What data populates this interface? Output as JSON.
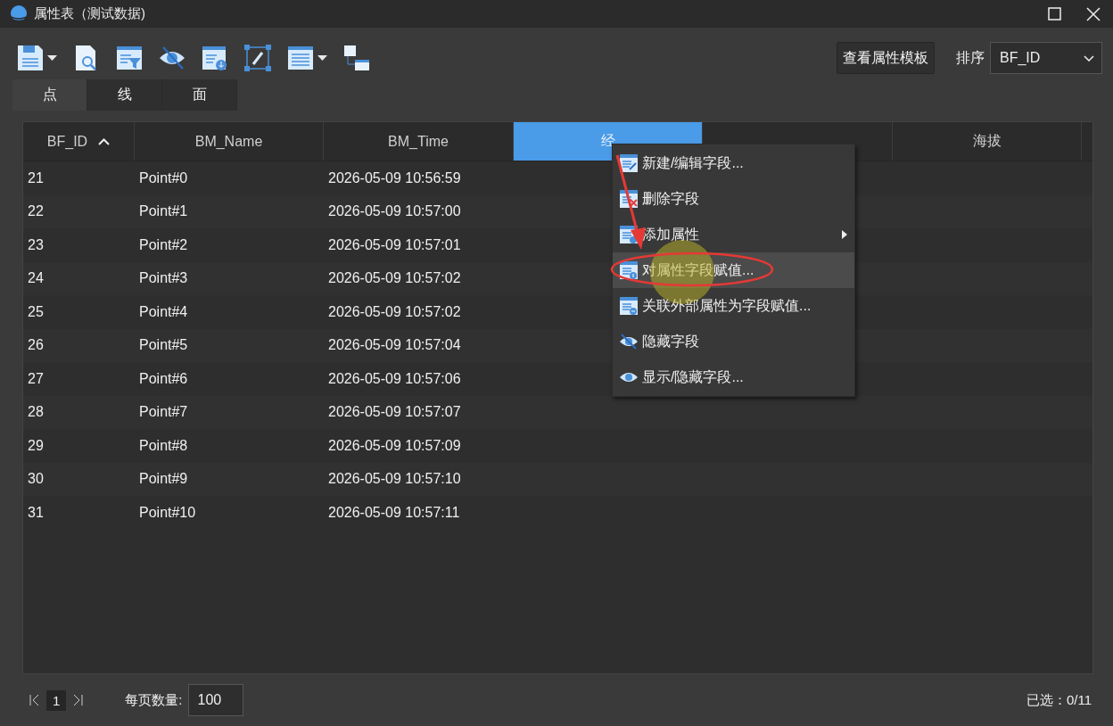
{
  "window": {
    "title": "属性表（测试数据)"
  },
  "toolbar": {
    "template_button": "查看属性模板",
    "sort_label": "排序",
    "sort_value": "BF_ID"
  },
  "tabs": [
    {
      "label": "点",
      "selected": true
    },
    {
      "label": "线",
      "selected": false
    },
    {
      "label": "面",
      "selected": false
    }
  ],
  "table": {
    "columns": [
      {
        "label": "BF_ID",
        "selected": false,
        "sorted": true
      },
      {
        "label": "BM_Name",
        "selected": false,
        "sorted": false
      },
      {
        "label": "BM_Time",
        "selected": false,
        "sorted": false
      },
      {
        "label": "经",
        "selected": true,
        "sorted": false
      },
      {
        "selected": false,
        "sorted": false
      },
      {
        "label": "海拔",
        "selected": false,
        "sorted": false
      }
    ],
    "rows": [
      [
        "21",
        "Point#0",
        "2026-05-09 10:56:59"
      ],
      [
        "22",
        "Point#1",
        "2026-05-09 10:57:00"
      ],
      [
        "23",
        "Point#2",
        "2026-05-09 10:57:01"
      ],
      [
        "24",
        "Point#3",
        "2026-05-09 10:57:02"
      ],
      [
        "25",
        "Point#4",
        "2026-05-09 10:57:02"
      ],
      [
        "26",
        "Point#5",
        "2026-05-09 10:57:04"
      ],
      [
        "27",
        "Point#6",
        "2026-05-09 10:57:06"
      ],
      [
        "28",
        "Point#7",
        "2026-05-09 10:57:07"
      ],
      [
        "29",
        "Point#8",
        "2026-05-09 10:57:09"
      ],
      [
        "30",
        "Point#9",
        "2026-05-09 10:57:10"
      ],
      [
        "31",
        "Point#10",
        "2026-05-09 10:57:11"
      ]
    ]
  },
  "context_menu": {
    "items": [
      {
        "label": "新建/编辑字段...",
        "kind": "edit",
        "submenu": false,
        "selected": false
      },
      {
        "label": "删除字段",
        "kind": "delete",
        "submenu": false,
        "selected": false
      },
      {
        "label": "添加属性",
        "kind": "add",
        "submenu": true,
        "selected": false
      },
      {
        "label": "对属性字段赋值...",
        "kind": "assign",
        "submenu": false,
        "selected": true
      },
      {
        "label": "关联外部属性为字段赋值...",
        "kind": "link",
        "submenu": false,
        "selected": false
      },
      {
        "label": "隐藏字段",
        "kind": "hide",
        "submenu": false,
        "selected": false
      },
      {
        "label": "显示/隐藏字段...",
        "kind": "show",
        "submenu": false,
        "selected": false
      }
    ]
  },
  "footer": {
    "page": "1",
    "page_size_label": "每页数量:",
    "page_size": "100",
    "selection": "已选：0/11"
  }
}
